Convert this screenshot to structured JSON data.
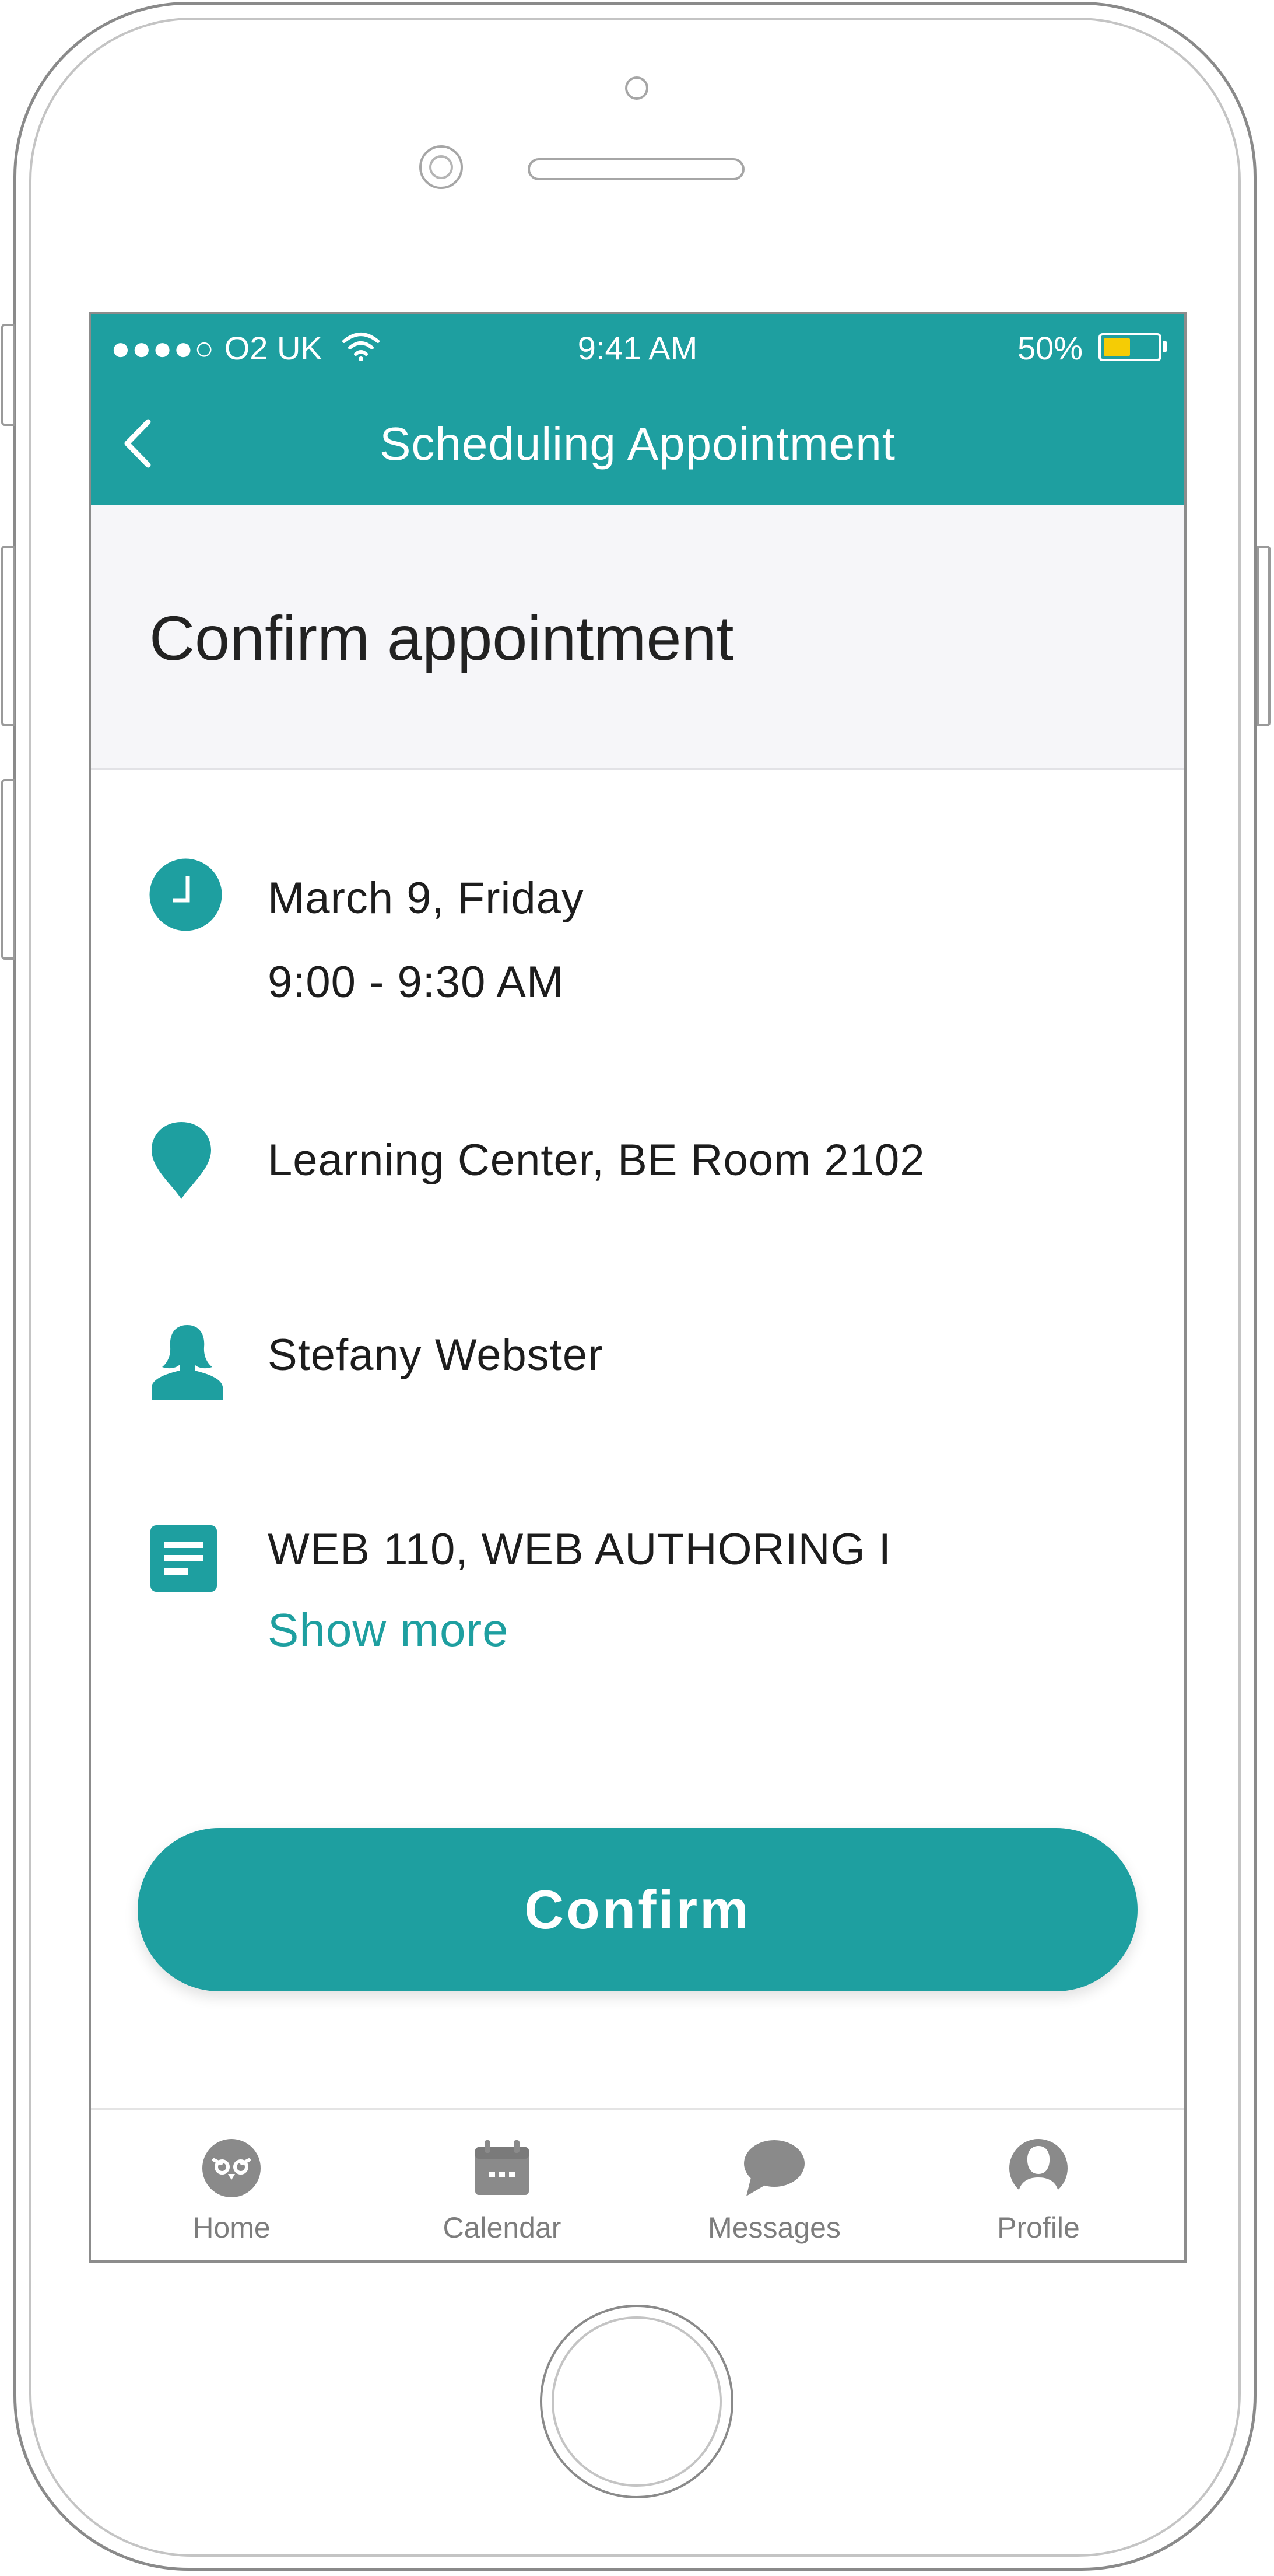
{
  "status_bar": {
    "signal_dots": "●●●●○",
    "carrier": "O2 UK",
    "time": "9:41 AM",
    "battery_percent": "50%",
    "battery_level": 0.5,
    "battery_color": "#f5cc05"
  },
  "nav": {
    "back_icon": "chevron-left-icon",
    "title": "Scheduling Appointment"
  },
  "header": {
    "title": "Confirm appointment"
  },
  "details": {
    "date": "March 9, Friday",
    "time_range": "9:00 - 9:30 AM",
    "location": "Learning Center, BE Room 2102",
    "person": "Stefany Webster",
    "course": "WEB 110, WEB AUTHORING I",
    "show_more_label": "Show more",
    "icons": [
      "clock-icon",
      "location-pin-icon",
      "person-icon",
      "document-icon"
    ]
  },
  "confirm_button": {
    "label": "Confirm"
  },
  "tab_bar": {
    "tabs": [
      {
        "label": "Home",
        "icon": "owl-icon"
      },
      {
        "label": "Calendar",
        "icon": "calendar-icon"
      },
      {
        "label": "Messages",
        "icon": "chat-bubble-icon"
      },
      {
        "label": "Profile",
        "icon": "profile-icon"
      }
    ]
  },
  "colors": {
    "accent": "#1e9fa0",
    "header_background": "#f6f6f9",
    "tab_icon": "#8a8a8a"
  }
}
